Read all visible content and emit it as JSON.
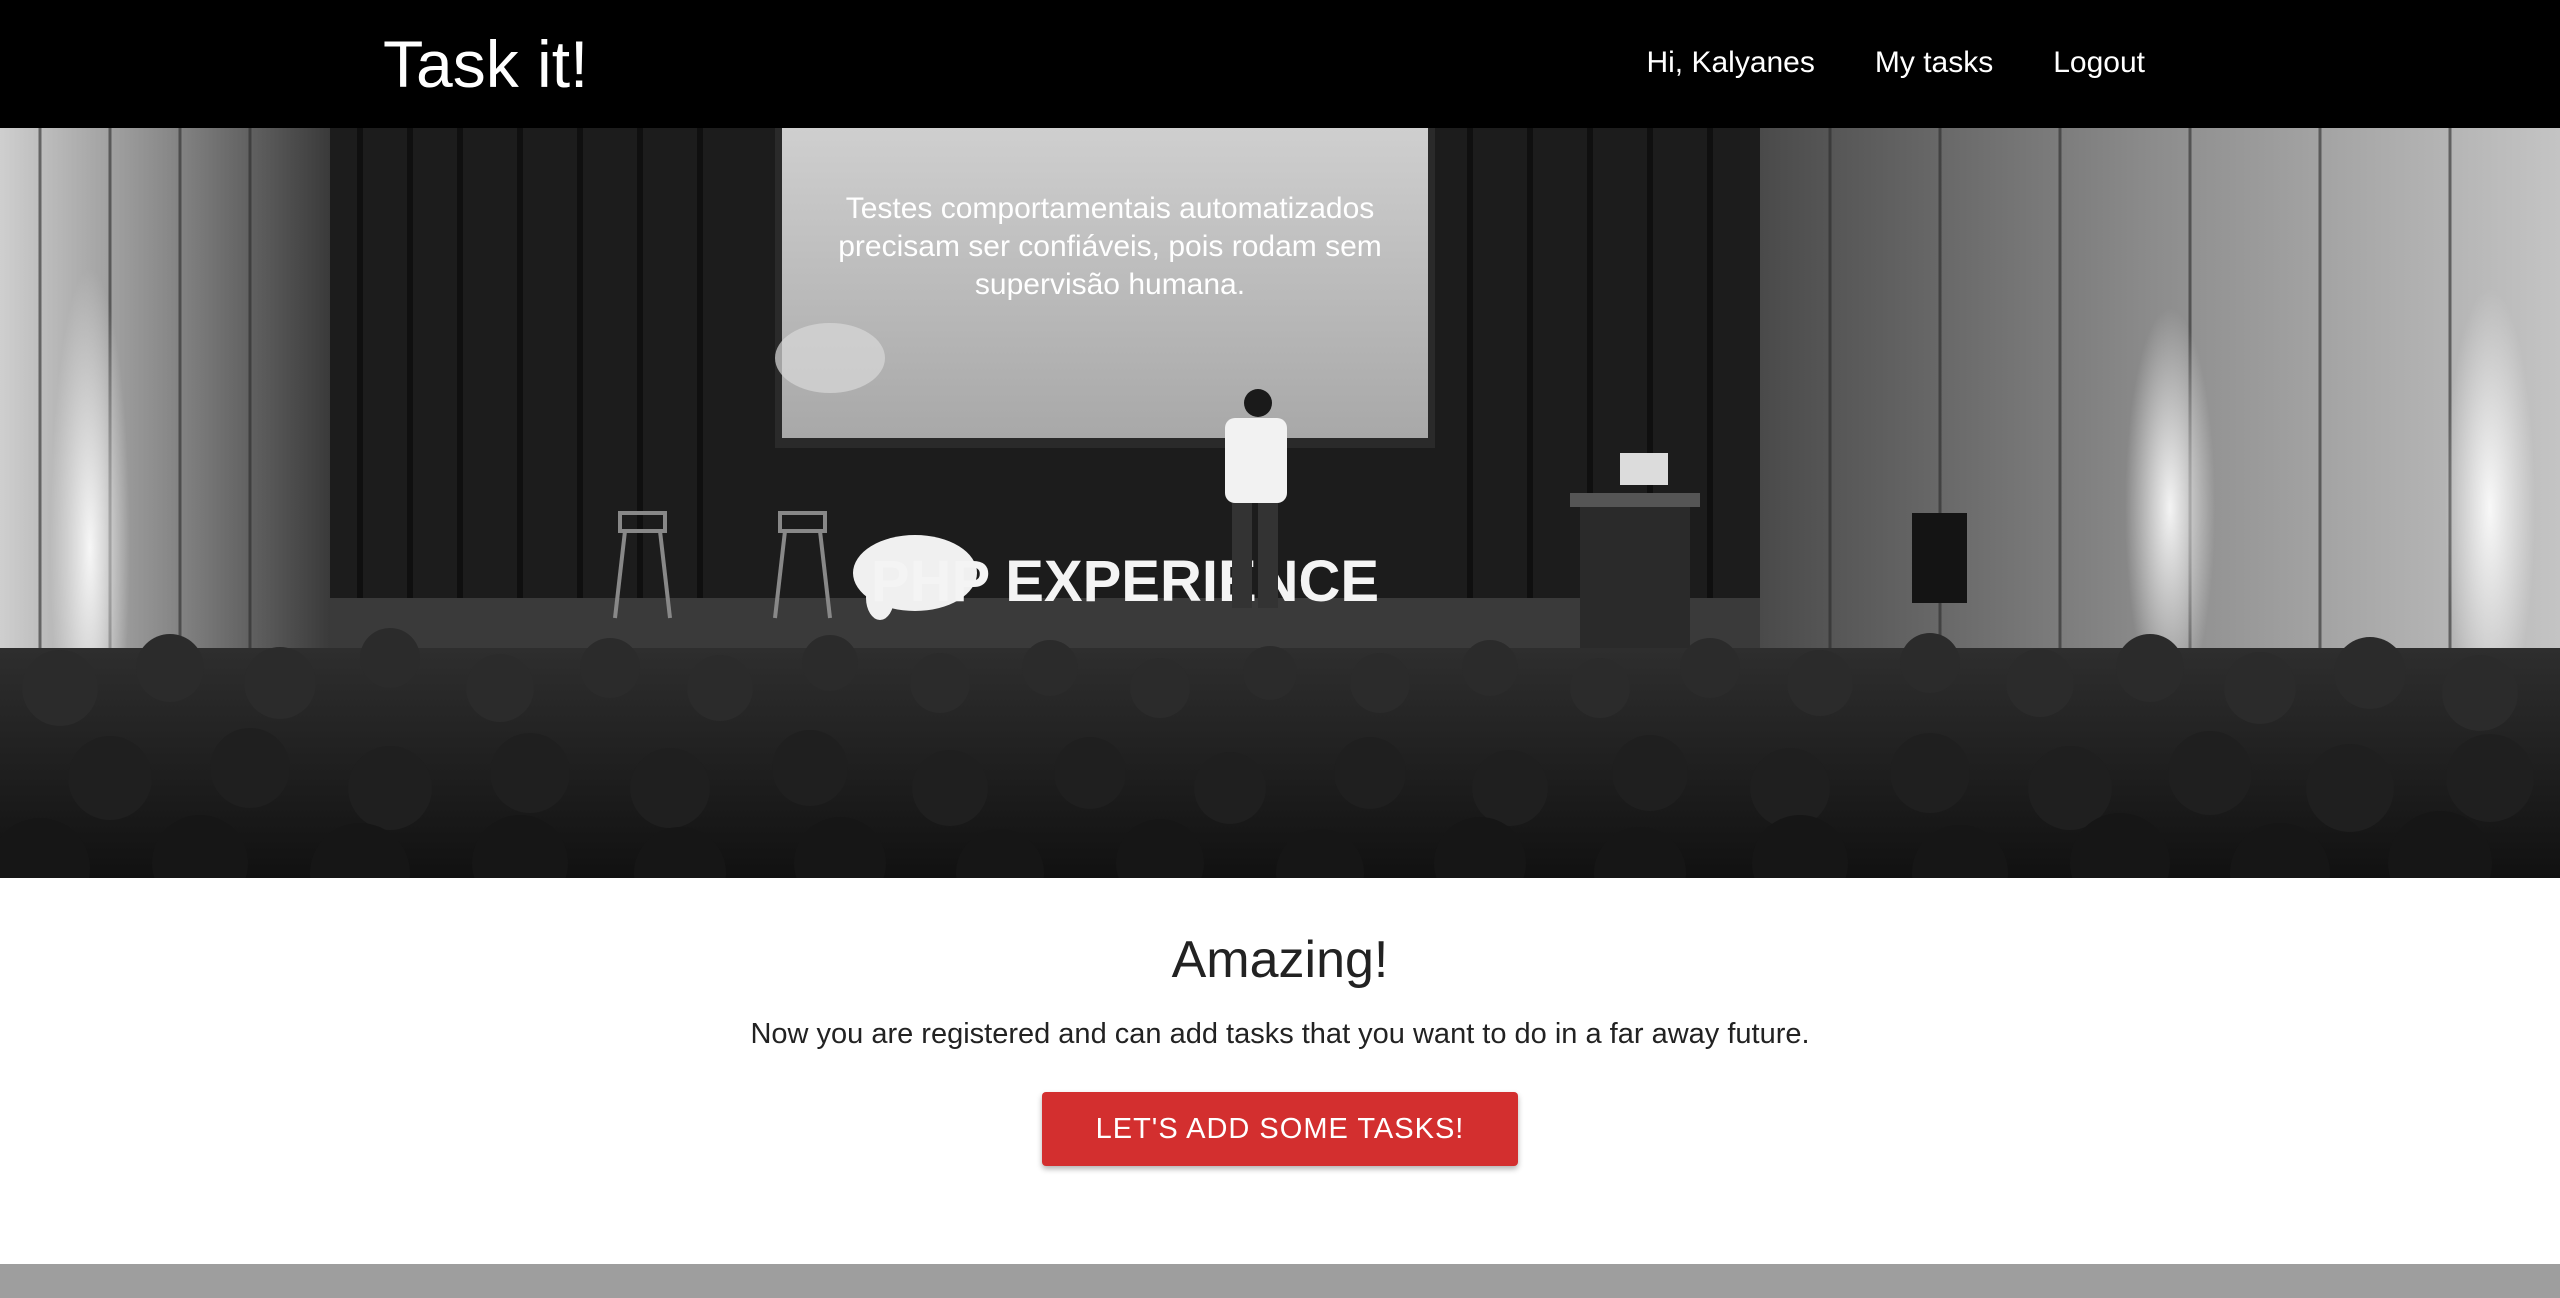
{
  "nav": {
    "brand": "Task it!",
    "greeting": "Hi, Kalyanes",
    "my_tasks": "My tasks",
    "logout": "Logout"
  },
  "hero": {
    "screen_text_line1": "Testes comportamentais automatizados",
    "screen_text_line2": "precisam ser confiáveis, pois rodam sem",
    "screen_text_line3": "supervisão humana.",
    "banner_text": "PHP EXPERIENCE"
  },
  "main": {
    "title": "Amazing!",
    "message": "Now you are registered and can add tasks that you want to do in a far away future.",
    "cta_label": "LET'S ADD SOME TASKS!"
  },
  "colors": {
    "navbar_bg": "#000000",
    "accent": "#d32f2f",
    "footer": "#9e9e9e"
  }
}
